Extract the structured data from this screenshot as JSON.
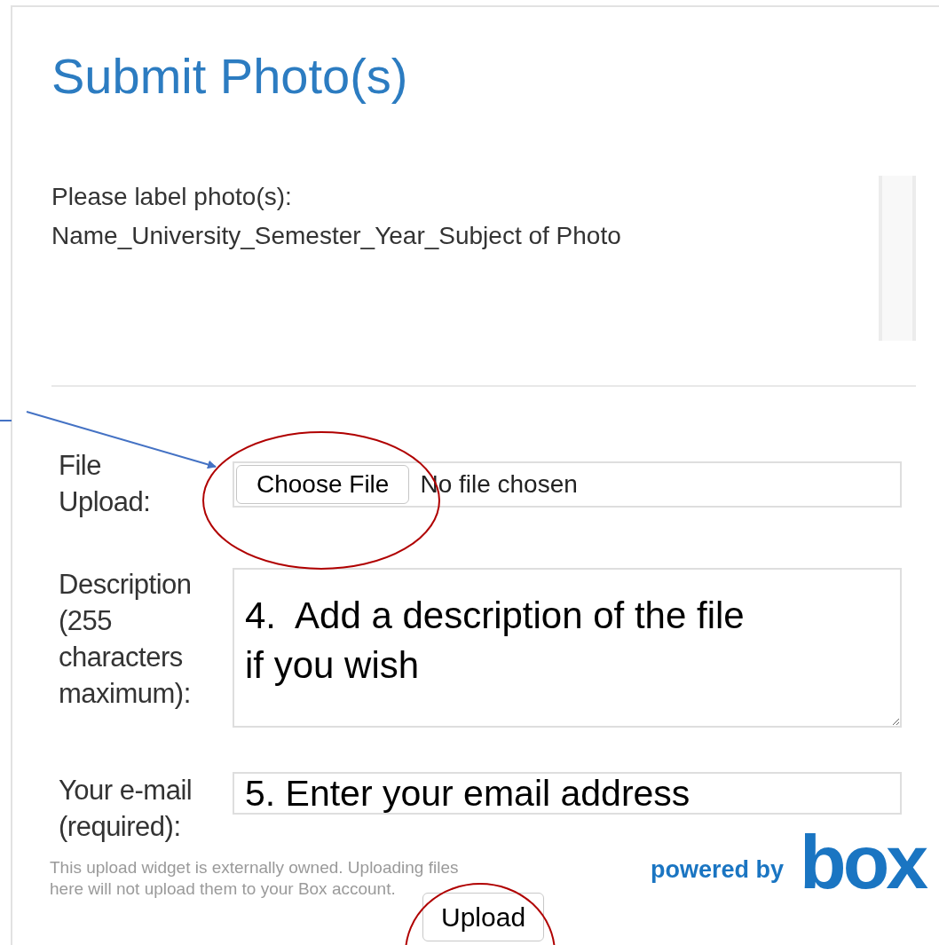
{
  "title": "Submit Photo(s)",
  "instructions": [
    "Please label photo(s):",
    "Name_University_Semester_Year_Subject of Photo"
  ],
  "fields": [
    {
      "kind": "file",
      "label": "File Upload:",
      "button": "Choose File",
      "status": "No file chosen"
    },
    {
      "kind": "textarea",
      "label": "Description (255 characters maximum):",
      "value": "4.  Add a description of the file if you wish"
    },
    {
      "kind": "text",
      "label": "Your e-mail (required):",
      "value": "5. Enter your email address"
    }
  ],
  "notice": "This upload widget is externally owned. Uploading files here will not upload them to your Box account.",
  "powered_by": "powered by",
  "logo": "box",
  "submit": "Upload"
}
